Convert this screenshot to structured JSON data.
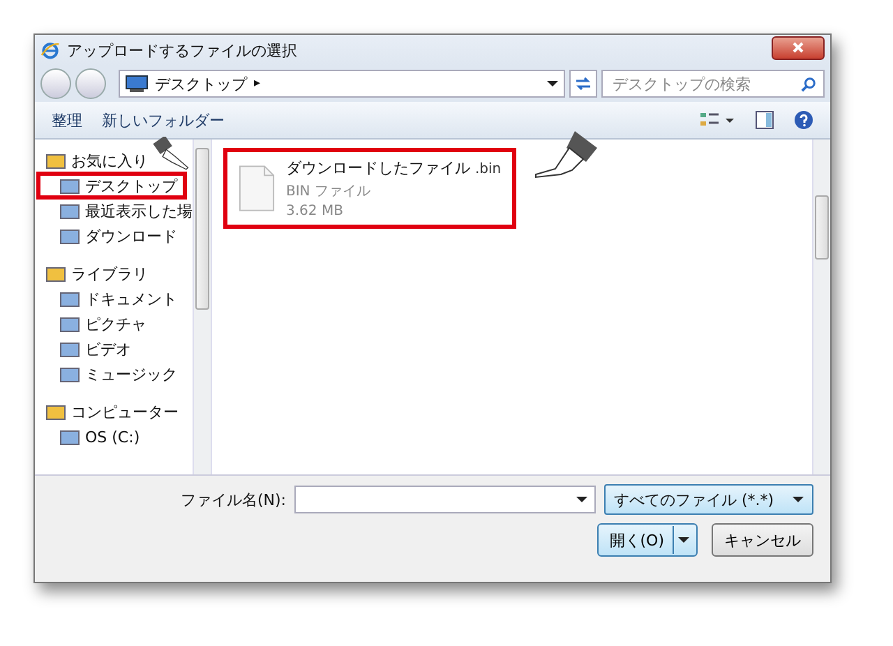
{
  "window": {
    "title": "アップロードするファイルの選択"
  },
  "address_bar": {
    "location": "デスクトップ",
    "arrow": "▸"
  },
  "search": {
    "placeholder": "デスクトップの検索"
  },
  "toolbar": {
    "items": [
      "整理",
      "新しいフォルダー"
    ]
  },
  "sidebar": {
    "items": [
      {
        "kind": "header",
        "label": "お気に入り",
        "highlighted": false
      },
      {
        "kind": "item",
        "label": "デスクトップ",
        "highlighted": true
      },
      {
        "kind": "item",
        "label": "最近表示した場",
        "highlighted": false
      },
      {
        "kind": "item",
        "label": "ダウンロード",
        "highlighted": false
      },
      {
        "kind": "header",
        "label": "ライブラリ",
        "highlighted": false
      },
      {
        "kind": "item",
        "label": "ドキュメント",
        "highlighted": false
      },
      {
        "kind": "item",
        "label": "ピクチャ",
        "highlighted": false
      },
      {
        "kind": "item",
        "label": "ビデオ",
        "highlighted": false
      },
      {
        "kind": "item",
        "label": "ミュージック",
        "highlighted": false
      },
      {
        "kind": "header",
        "label": "コンピューター",
        "highlighted": false
      },
      {
        "kind": "item",
        "label": "OS (C:)",
        "highlighted": false
      }
    ]
  },
  "files": [
    {
      "name": "ダウンロードしたファイル",
      "extension": ".bin",
      "type": "BIN ファイル",
      "size": "3.62 MB",
      "highlighted": true
    }
  ],
  "filename": {
    "label": "ファイル名(N):"
  },
  "filter": {
    "value": "すべてのファイル (*.*)"
  },
  "buttons": [
    {
      "kind": "split",
      "label": "開く(O)"
    },
    {
      "kind": "plain",
      "label": "キャンセル"
    }
  ]
}
